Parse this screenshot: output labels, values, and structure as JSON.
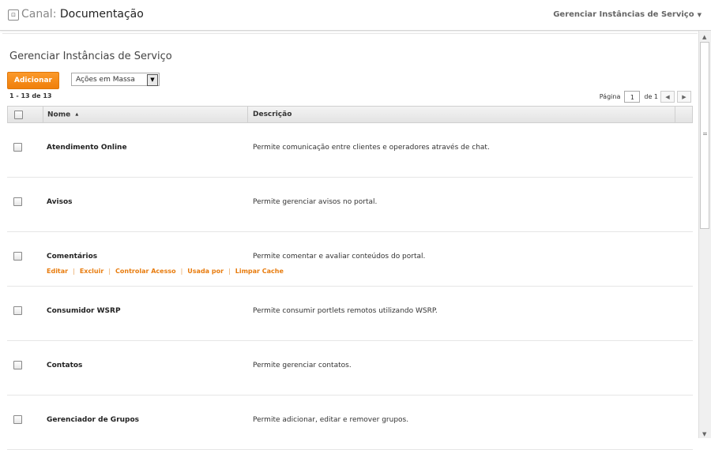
{
  "header": {
    "app_icon": "panel-icon",
    "canal_label": "Canal:",
    "site_name": "Documentação",
    "menu_label": "Gerenciar Instâncias de Serviço"
  },
  "page": {
    "title": "Gerenciar Instâncias de Serviço",
    "add_label": "Adicionar",
    "bulk_actions_value": "Ações em Massa",
    "results_count": "1 - 13 de 13",
    "pager": {
      "page_label": "Página",
      "current_page": "1",
      "of_label": "de 1"
    }
  },
  "table": {
    "columns": [
      "Nome",
      "Descrição"
    ],
    "sort_indicator": "▲",
    "rows": [
      {
        "name": "Atendimento Online",
        "description": "Permite comunicação entre clientes e operadores através de chat."
      },
      {
        "name": "Avisos",
        "description": "Permite gerenciar avisos no portal."
      },
      {
        "name": "Comentários",
        "description": "Permite comentar e avaliar conteúdos do portal."
      },
      {
        "name": "Consumidor WSRP",
        "description": "Permite consumir portlets remotos utilizando WSRP."
      },
      {
        "name": "Contatos",
        "description": "Permite gerenciar contatos."
      },
      {
        "name": "Gerenciador de Grupos",
        "description": "Permite adicionar, editar e remover grupos."
      }
    ],
    "row_actions": [
      "Editar",
      "Excluir",
      "Controlar Acesso",
      "Usada por",
      "Limpar Cache"
    ]
  },
  "colors": {
    "accent": "#f08a1c",
    "link": "#e87c0e"
  }
}
